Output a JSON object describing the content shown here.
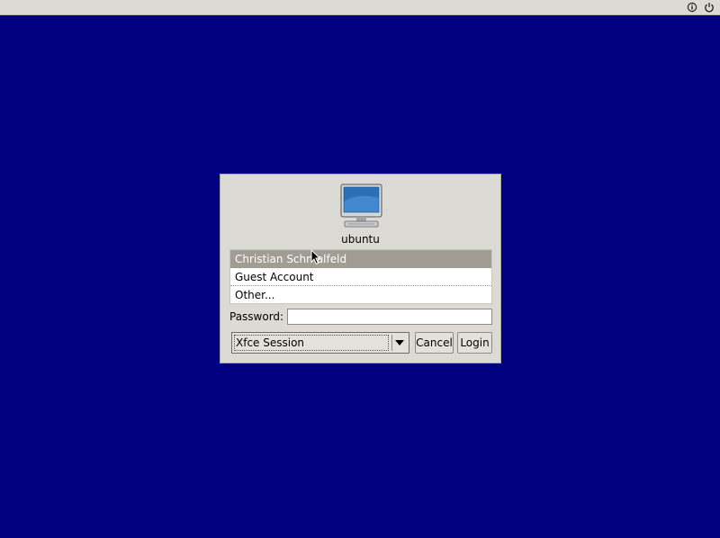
{
  "topbar": {
    "icons": [
      "info-icon",
      "power-icon"
    ]
  },
  "dialog": {
    "hostname": "ubuntu",
    "users": [
      {
        "label": "Christian Schmalfeld",
        "selected": true
      },
      {
        "label": "Guest Account",
        "selected": false
      },
      {
        "label": "Other...",
        "selected": false
      }
    ],
    "password_label": "Password:",
    "password_value": "",
    "session": "Xfce Session",
    "cancel_label": "Cancel",
    "login_label": "Login"
  },
  "colors": {
    "desktop": "#000080",
    "panel": "#dcdad5",
    "selection": "#a29d94"
  }
}
